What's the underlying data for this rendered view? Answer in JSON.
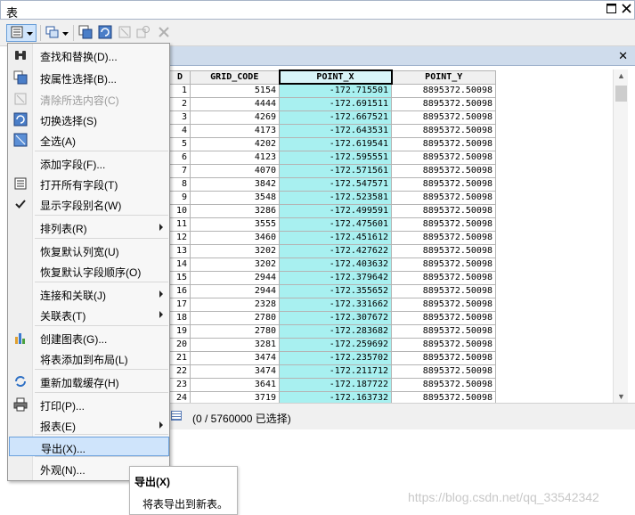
{
  "window": {
    "title": "表"
  },
  "table": {
    "columns": [
      "D",
      "GRID_CODE",
      "POINT_X",
      "POINT_Y"
    ],
    "rows": [
      [
        "1",
        "5154",
        "-172.715501",
        "8895372.50098"
      ],
      [
        "2",
        "4444",
        "-172.691511",
        "8895372.50098"
      ],
      [
        "3",
        "4269",
        "-172.667521",
        "8895372.50098"
      ],
      [
        "4",
        "4173",
        "-172.643531",
        "8895372.50098"
      ],
      [
        "5",
        "4202",
        "-172.619541",
        "8895372.50098"
      ],
      [
        "6",
        "4123",
        "-172.595551",
        "8895372.50098"
      ],
      [
        "7",
        "4070",
        "-172.571561",
        "8895372.50098"
      ],
      [
        "8",
        "3842",
        "-172.547571",
        "8895372.50098"
      ],
      [
        "9",
        "3548",
        "-172.523581",
        "8895372.50098"
      ],
      [
        "10",
        "3286",
        "-172.499591",
        "8895372.50098"
      ],
      [
        "11",
        "3555",
        "-172.475601",
        "8895372.50098"
      ],
      [
        "12",
        "3460",
        "-172.451612",
        "8895372.50098"
      ],
      [
        "13",
        "3202",
        "-172.427622",
        "8895372.50098"
      ],
      [
        "14",
        "3202",
        "-172.403632",
        "8895372.50098"
      ],
      [
        "15",
        "2944",
        "-172.379642",
        "8895372.50098"
      ],
      [
        "16",
        "2944",
        "-172.355652",
        "8895372.50098"
      ],
      [
        "17",
        "2328",
        "-172.331662",
        "8895372.50098"
      ],
      [
        "18",
        "2780",
        "-172.307672",
        "8895372.50098"
      ],
      [
        "19",
        "2780",
        "-172.283682",
        "8895372.50098"
      ],
      [
        "20",
        "3281",
        "-172.259692",
        "8895372.50098"
      ],
      [
        "21",
        "3474",
        "-172.235702",
        "8895372.50098"
      ],
      [
        "22",
        "3474",
        "-172.211712",
        "8895372.50098"
      ],
      [
        "23",
        "3641",
        "-172.187722",
        "8895372.50098"
      ],
      [
        "24",
        "3719",
        "-172.163732",
        "8895372.50098"
      ]
    ],
    "selected_column": "POINT_X"
  },
  "status": {
    "text": "(0 / 5760000 已选择)"
  },
  "menu": {
    "items": [
      {
        "label": "查找和替换(D)...",
        "icon": "binoculars-icon"
      },
      {
        "label": "按属性选择(B)...",
        "icon": "select-by-attributes-icon"
      },
      {
        "label": "清除所选内容(C)",
        "icon": "clear-selection-icon",
        "disabled": true
      },
      {
        "label": "切换选择(S)",
        "icon": "switch-selection-icon"
      },
      {
        "label": "全选(A)",
        "icon": "select-all-icon"
      },
      {
        "label": "添加字段(F)...",
        "icon": ""
      },
      {
        "label": "打开所有字段(T)",
        "icon": "fields-list-icon"
      },
      {
        "label": "显示字段别名(W)",
        "icon": "checkmark-icon"
      },
      {
        "label": "排列表(R)",
        "icon": "",
        "submenu": true
      },
      {
        "label": "恢复默认列宽(U)",
        "icon": ""
      },
      {
        "label": "恢复默认字段顺序(O)",
        "icon": ""
      },
      {
        "label": "连接和关联(J)",
        "icon": "",
        "submenu": true
      },
      {
        "label": "关联表(T)",
        "icon": "",
        "submenu": true
      },
      {
        "label": "创建图表(G)...",
        "icon": "bar-chart-icon"
      },
      {
        "label": "将表添加到布局(L)",
        "icon": ""
      },
      {
        "label": "重新加载缓存(H)",
        "icon": "reload-icon"
      },
      {
        "label": "打印(P)...",
        "icon": "printer-icon"
      },
      {
        "label": "报表(E)",
        "icon": "",
        "submenu": true
      },
      {
        "label": "导出(X)...",
        "icon": "",
        "highlight": true
      },
      {
        "label": "外观(N)...",
        "icon": ""
      }
    ]
  },
  "tooltip": {
    "title": "导出(X)",
    "body": "将表导出到新表。"
  },
  "watermark": "https://blog.csdn.net/qq_33542342",
  "colors": {
    "selected_column": "#a8f0f0",
    "menu_highlight": "#cfe4fb"
  }
}
